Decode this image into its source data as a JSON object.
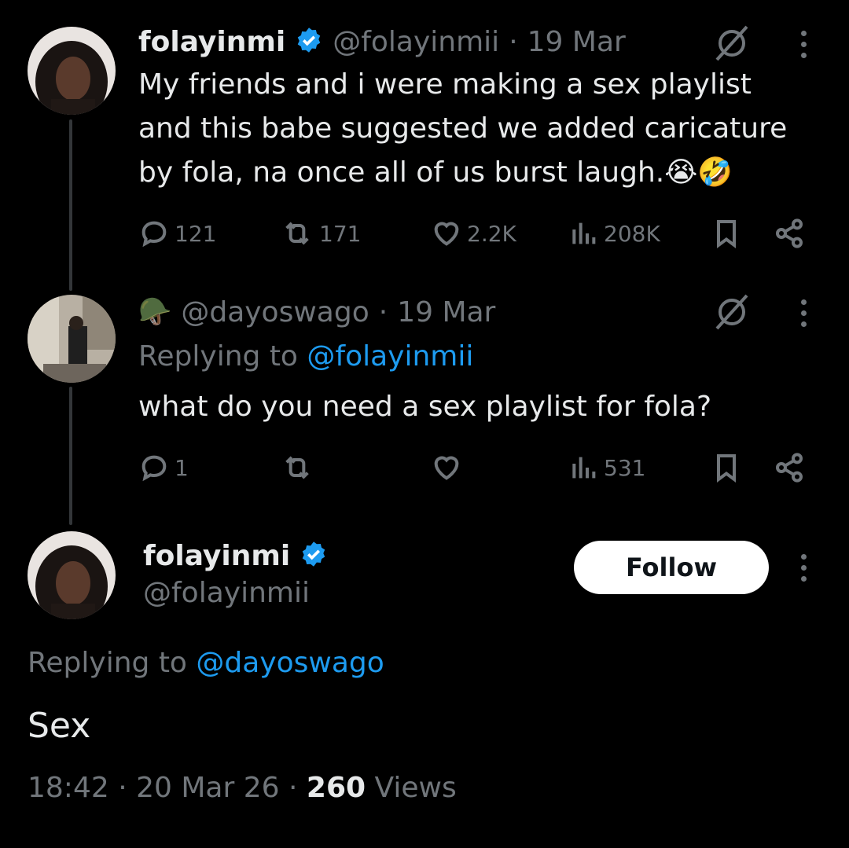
{
  "tweet1": {
    "display_name": "folayinmi",
    "handle": "@folayinmii",
    "separator": "·",
    "date": "19 Mar",
    "text_line1": "My friends and i were making a sex playlist",
    "text_line2": "and this babe suggested we added caricature",
    "text_line3": "by fola, na once all of us burst laugh.",
    "emoji": "😭🤣",
    "replies": "121",
    "reposts": "171",
    "likes": "2.2K",
    "views": "208K"
  },
  "tweet2": {
    "emoji_name": "🪖",
    "handle": "@dayoswago",
    "separator": "·",
    "date": "19 Mar",
    "replying_prefix": "Replying to",
    "replying_to": "@folayinmii",
    "text": "what do you need a sex playlist for fola?",
    "replies": "1",
    "views": "531"
  },
  "main_tweet": {
    "display_name": "folayinmi",
    "handle": "@folayinmii",
    "follow_label": "Follow",
    "replying_prefix": "Replying to",
    "replying_to": "@dayoswago",
    "text": "Sex",
    "time": "18:42",
    "separator": "·",
    "date": "20 Mar 26",
    "views_count": "260",
    "views_label": "Views"
  },
  "colors": {
    "background": "#000000",
    "text": "#e7e9ea",
    "muted": "#71767b",
    "link": "#1d9bf0",
    "verified": "#1d9bf0"
  }
}
